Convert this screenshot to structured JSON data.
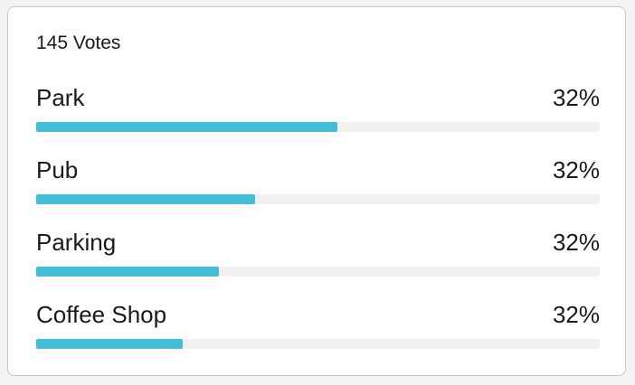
{
  "poll": {
    "vote_count_label": "145 Votes",
    "accent_color": "#45bcd8",
    "track_color": "#f1f1f1",
    "options": [
      {
        "label": "Park",
        "percent_label": "32%",
        "bar_fill_fraction": 0.534
      },
      {
        "label": "Pub",
        "percent_label": "32%",
        "bar_fill_fraction": 0.389
      },
      {
        "label": "Parking",
        "percent_label": "32%",
        "bar_fill_fraction": 0.325
      },
      {
        "label": "Coffee Shop",
        "percent_label": "32%",
        "bar_fill_fraction": 0.26
      }
    ]
  }
}
